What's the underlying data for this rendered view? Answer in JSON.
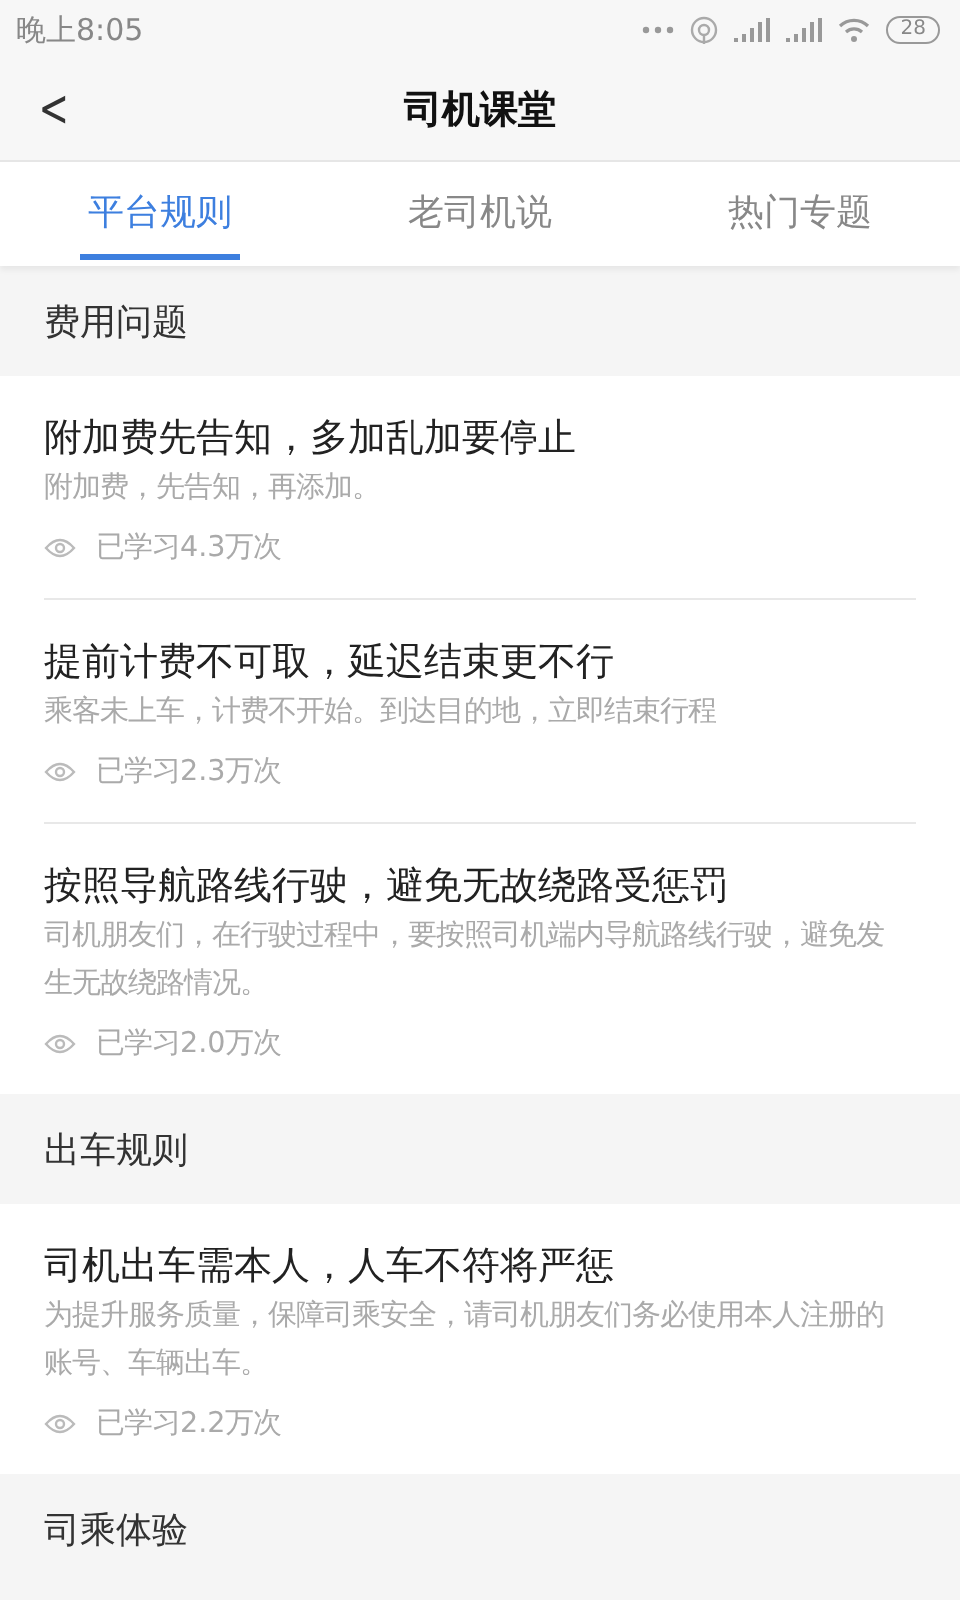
{
  "status_bar": {
    "time": "晚上8:05",
    "battery": "28"
  },
  "header": {
    "back": "<",
    "title": "司机课堂"
  },
  "tabs": [
    {
      "label": "平台规则",
      "selected": true
    },
    {
      "label": "老司机说",
      "selected": false
    },
    {
      "label": "热门专题",
      "selected": false
    }
  ],
  "sections": [
    {
      "title": "费用问题",
      "articles": [
        {
          "title": "附加费先告知，多加乱加要停止",
          "summary": "附加费，先告知，再添加。",
          "views": "已学习4.3万次"
        },
        {
          "title": "提前计费不可取，延迟结束更不行",
          "summary": "乘客未上车，计费不开始。到达目的地，立即结束行程",
          "views": "已学习2.3万次"
        },
        {
          "title": "按照导航路线行驶，避免无故绕路受惩罚",
          "summary": "司机朋友们，在行驶过程中，要按照司机端内导航路线行驶，避免发生无故绕路情况。",
          "views": "已学习2.0万次"
        }
      ]
    },
    {
      "title": "出车规则",
      "articles": [
        {
          "title": "司机出车需本人，人车不符将严惩",
          "summary": "为提升服务质量，保障司乘安全，请司机朋友们务必使用本人注册的账号、车辆出车。",
          "views": "已学习2.2万次"
        }
      ]
    },
    {
      "title": "司乘体验"
    }
  ]
}
